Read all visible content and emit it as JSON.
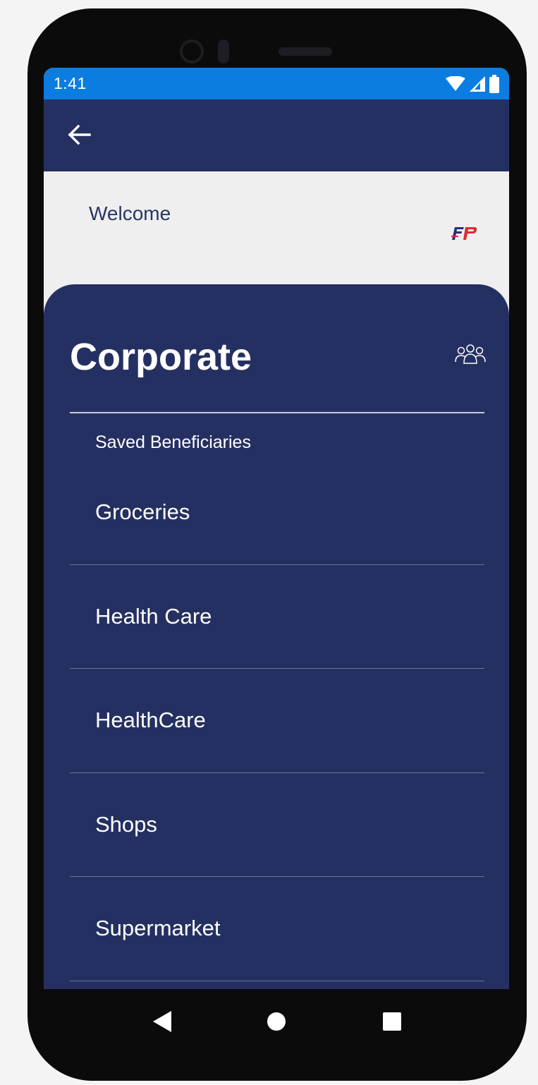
{
  "status_bar": {
    "time": "1:41",
    "icons": [
      "wifi-icon",
      "signal-icon",
      "battery-icon"
    ]
  },
  "app_bar": {
    "back_icon": "arrow-left-icon"
  },
  "header": {
    "welcome": "Welcome",
    "logo_text": "FP"
  },
  "sheet": {
    "title": "Corporate",
    "title_icon": "group-icon",
    "section_label": "Saved Beneficiaries",
    "items": [
      {
        "label": "Groceries"
      },
      {
        "label": "Health Care"
      },
      {
        "label": "HealthCare"
      },
      {
        "label": "Shops"
      },
      {
        "label": "Supermarket"
      }
    ]
  },
  "nav_bar": {
    "buttons": [
      "back-triangle-icon",
      "home-circle-icon",
      "recents-square-icon"
    ]
  },
  "colors": {
    "status_bar": "#0b7de0",
    "app_bar": "#253062",
    "sheet": "#253062",
    "background": "#efeff0"
  }
}
